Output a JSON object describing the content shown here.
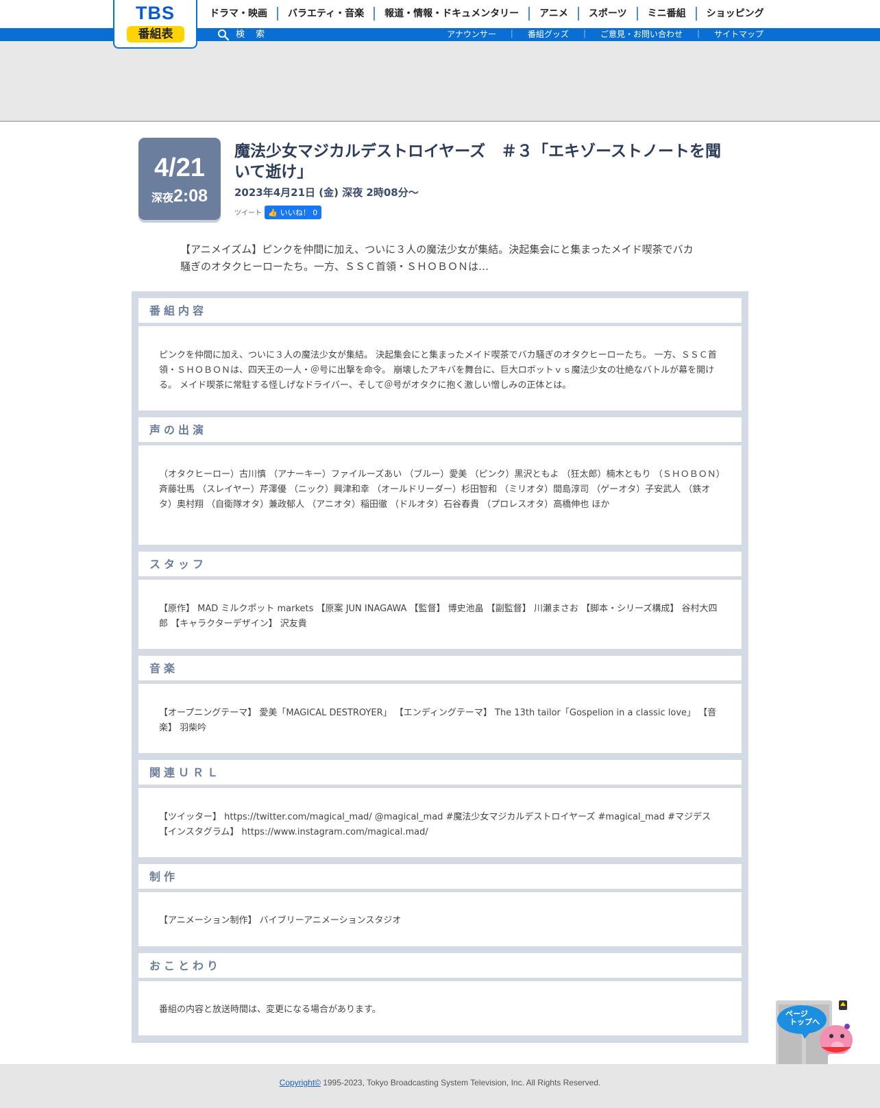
{
  "header": {
    "logo_text": "TBS",
    "logo_label": "番組表",
    "main_nav": [
      "ドラマ・映画",
      "バラエティ・音楽",
      "報道・情報・ドキュメンタリー",
      "アニメ",
      "スポーツ",
      "ミニ番組",
      "ショッピング"
    ],
    "search_label": "検 索",
    "sub_nav": [
      "アナウンサー",
      "番組グッズ",
      "ご意見・お問い合わせ",
      "サイトマップ"
    ],
    "sub_nav_separator": "｜"
  },
  "program": {
    "date_day": "4/21",
    "time_prefix": "深夜",
    "time_clock": "2:08",
    "title": "魔法少女マジカルデストロイヤーズ　＃３「エキゾーストノートを聞いて逝け」",
    "air_datetime": "2023年4月21日 (金) 深夜 2時08分〜",
    "tweet_label": "ツイート",
    "like_label": "いいね！ 0",
    "lead": "【アニメイズム】ピンクを仲間に加え、ついに３人の魔法少女が集結。決起集会にと集まったメイド喫茶でバカ騒ぎのオタクヒーローたち。一方、ＳＳＣ首領・ＳＨＯＢＯＮは…"
  },
  "sections": [
    {
      "title": "番組内容",
      "body": "ピンクを仲間に加え、ついに３人の魔法少女が集結。 決起集会にと集まったメイド喫茶でバカ騒ぎのオタクヒーローたち。 一方、ＳＳＣ首領・ＳＨＯＢＯＮは、四天王の一人・＠号に出撃を命令。 崩壊したアキバを舞台に、巨大ロボットｖｓ魔法少女の壮絶なバトルが幕を開ける。 メイド喫茶に常駐する怪しげなドライバー、そして＠号がオタクに抱く激しい憎しみの正体とは。"
    },
    {
      "title": "声の出演",
      "body": "（オタクヒーロー）古川慎 （アナーキー）ファイルーズあい （ブルー）愛美 （ピンク）黒沢ともよ （狂太郎）楠木ともり （ＳＨＯＢＯＮ）斉藤壮馬 （スレイヤー）芹澤優 （ニック）興津和幸 （オールドリーダー）杉田智和 （ミリオタ）間島淳司 （ゲーオタ）子安武人 （鉄オタ）奥村翔 （自衛隊オタ）兼政郁人 （アニオタ）稲田徹 （ドルオタ）石谷春貴 （プロレスオタ）高橋伸也 ほか"
    },
    {
      "title": "スタッフ",
      "body": "【原作】 MAD ミルクポット markets 【原案 JUN INAGAWA 【監督】 博史池畠 【副監督】 川瀬まさお 【脚本・シリーズ構成】 谷村大四郎 【キャラクターデザイン】 沢友貴"
    },
    {
      "title": "音楽",
      "body": "【オープニングテーマ】 愛美「MAGICAL DESTROYER」 【エンディングテーマ】 The 13th tailor「Gospelion in a classic love」 【音楽】 羽柴吟"
    },
    {
      "title": "関連ＵＲＬ",
      "body": "【ツイッター】 https://twitter.com/magical_mad/ @magical_mad #魔法少女マジカルデストロイヤーズ #magical_mad #マジデス 【インスタグラム】 https://www.instagram.com/magical.mad/"
    },
    {
      "title": "制作",
      "body": "【アニメーション制作】 バイブリーアニメーションスタジオ"
    },
    {
      "title": "おことわり",
      "body": "番組の内容と放送時間は、変更になる場合があります。"
    }
  ],
  "footer": {
    "copyright_link": "Copyright©",
    "copyright_text": " 1995-2023, Tokyo Broadcasting System Television, Inc. All Rights Reserved."
  },
  "pagetop": {
    "label_line1": "ページ",
    "label_line2": "トップへ"
  },
  "colors": {
    "brand_blue": "#0a6fd2",
    "logo_yellow": "#ffd400",
    "date_box": "#6c7e9e",
    "panel_bg": "#d4dbe5",
    "section_title": "#6b7d99"
  }
}
